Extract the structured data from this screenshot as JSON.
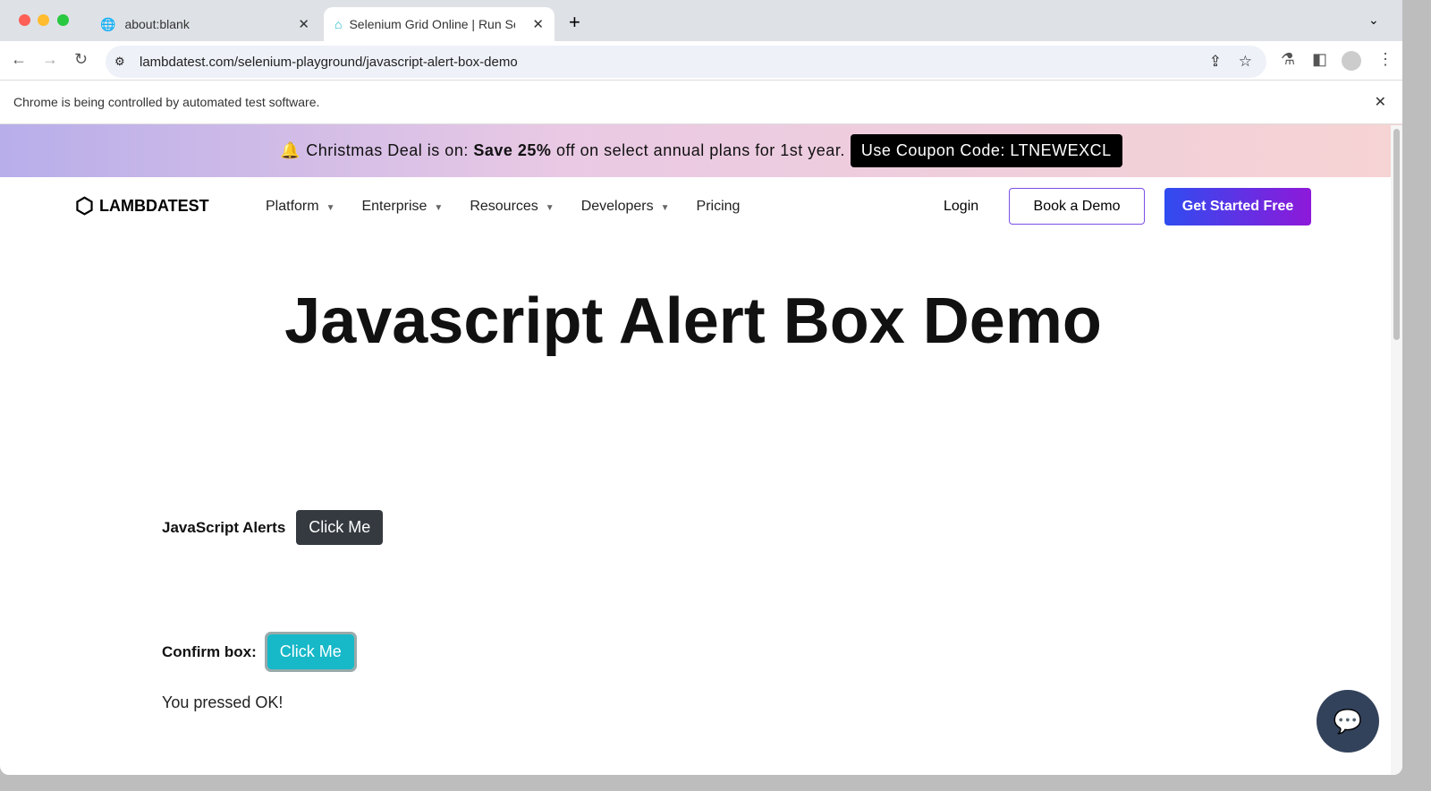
{
  "browser": {
    "tabs": [
      {
        "title": "about:blank"
      },
      {
        "title": "Selenium Grid Online | Run Sel"
      }
    ],
    "url": "lambdatest.com/selenium-playground/javascript-alert-box-demo",
    "infobar": "Chrome is being controlled by automated test software."
  },
  "promo": {
    "prefix": "Christmas Deal is on:",
    "bold": "Save 25%",
    "suffix": "off on select annual plans for 1st year.",
    "coupon": "Use Coupon Code: LTNEWEXCL"
  },
  "header": {
    "logo": "LAMBDATEST",
    "menu": [
      "Platform",
      "Enterprise",
      "Resources",
      "Developers",
      "Pricing"
    ],
    "login": "Login",
    "demo": "Book a Demo",
    "start": "Get Started Free"
  },
  "main": {
    "title": "Javascript Alert Box Demo",
    "alerts_label": "JavaScript Alerts",
    "alerts_button": "Click Me",
    "confirm_label": "Confirm box:",
    "confirm_button": "Click Me",
    "result": "You pressed OK!"
  }
}
